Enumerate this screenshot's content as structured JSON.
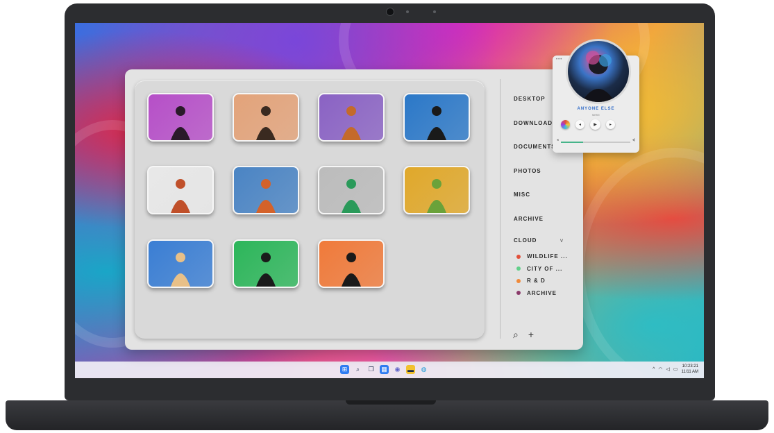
{
  "gallery": {
    "thumbnails": [
      {
        "name": "photo-woman-purple",
        "bg": "#b64fc8",
        "fg": "#2a1a2a"
      },
      {
        "name": "photo-peach-wall",
        "bg": "#e3a37a",
        "fg": "#3a2a20"
      },
      {
        "name": "photo-violet-stairs",
        "bg": "#8a62c4",
        "fg": "#c46a2a"
      },
      {
        "name": "photo-man-blue-yellow",
        "bg": "#2b78c8",
        "fg": "#1a1a1a"
      },
      {
        "name": "photo-white-wall",
        "bg": "#e8e8e8",
        "fg": "#c0502a"
      },
      {
        "name": "photo-man-orange",
        "bg": "#4a84c4",
        "fg": "#d4622a"
      },
      {
        "name": "photo-green-dress",
        "bg": "#bcbcbc",
        "fg": "#2a9a5a"
      },
      {
        "name": "photo-yellow-grass",
        "bg": "#e0a82a",
        "fg": "#6aa23a"
      },
      {
        "name": "photo-blue-brick",
        "bg": "#3a7ed4",
        "fg": "#e8c088"
      },
      {
        "name": "photo-green-stripes",
        "bg": "#2cb65a",
        "fg": "#1a1a1a"
      },
      {
        "name": "photo-orange-splash",
        "bg": "#f07a3a",
        "fg": "#1a1a1a"
      }
    ]
  },
  "sidebar": {
    "items": [
      {
        "label": "DESKTOP"
      },
      {
        "label": "DOWNLOADS"
      },
      {
        "label": "DOCUMENTS"
      },
      {
        "label": "PHOTOS"
      },
      {
        "label": "MISC"
      },
      {
        "label": "ARCHIVE"
      }
    ],
    "cloud": {
      "label": "CLOUD",
      "chevron": "v",
      "folders": [
        {
          "label": "WILDLIFE ...",
          "color": "#e2503a"
        },
        {
          "label": "CITY OF ...",
          "color": "#62d08a"
        },
        {
          "label": "R & D",
          "color": "#f08a3a"
        },
        {
          "label": "ARCHIVE",
          "color": "#8a3a6a"
        }
      ]
    },
    "tools": {
      "search_icon": "⌕",
      "add_icon": "+"
    }
  },
  "player": {
    "menu": "•••",
    "song": "ANYONE ELSE",
    "artist": "MIRIE",
    "progress": 0.32
  },
  "taskbar": {
    "clock_time": "10:23:21",
    "clock_date": "11/11 AM"
  }
}
